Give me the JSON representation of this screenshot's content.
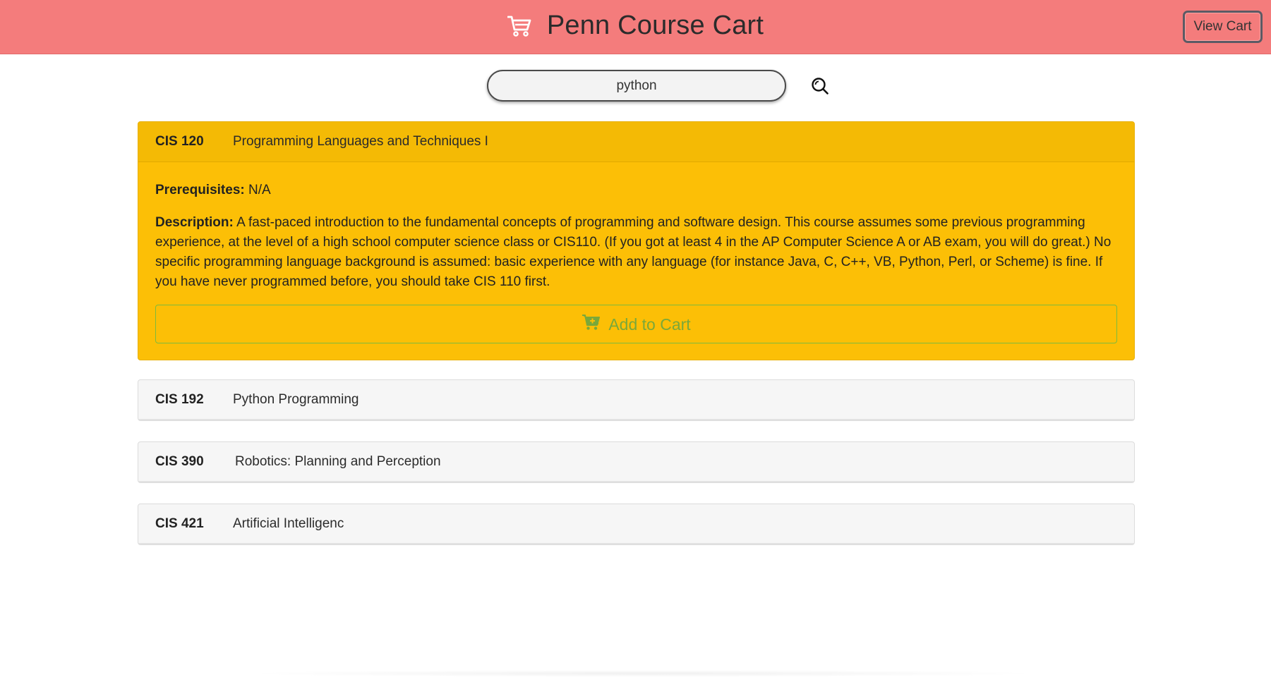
{
  "header": {
    "title": "Penn Course Cart",
    "view_cart_label": "View Cart",
    "brand_icon": "cart-icon",
    "background_color": "#f47c7c"
  },
  "search": {
    "value": "python",
    "button_icon": "search-icon"
  },
  "courses": [
    {
      "code": "CIS 120",
      "title": "Programming Languages and Techniques I",
      "expanded": true,
      "prerequisites_label": "Prerequisites:",
      "prerequisites": "N/A",
      "description_label": "Description:",
      "description": "A fast-paced introduction to the fundamental concepts of programming and software design. This course assumes some previous programming experience, at the level of a high school computer science class or CIS110. (If you got at least 4 in the AP Computer Science A or AB exam, you will do great.) No specific programming language background is assumed: basic experience with any language (for instance Java, C, C++, VB, Python, Perl, or Scheme) is fine. If you have never programmed before, you should take CIS 110 first.",
      "add_to_cart_label": "Add to Cart",
      "add_icon": "cart-plus-icon"
    },
    {
      "code": "CIS 192",
      "title": "Python Programming",
      "expanded": false
    },
    {
      "code": "CIS 390",
      "title": "Robotics: Planning and Perception",
      "expanded": false
    },
    {
      "code": "CIS 421",
      "title": "Artificial Intelligenc",
      "expanded": false
    }
  ],
  "colors": {
    "expanded_card": "#fcbf06",
    "collapsed_card": "#f6f6f6",
    "add_to_cart_text": "#7aa83a"
  }
}
